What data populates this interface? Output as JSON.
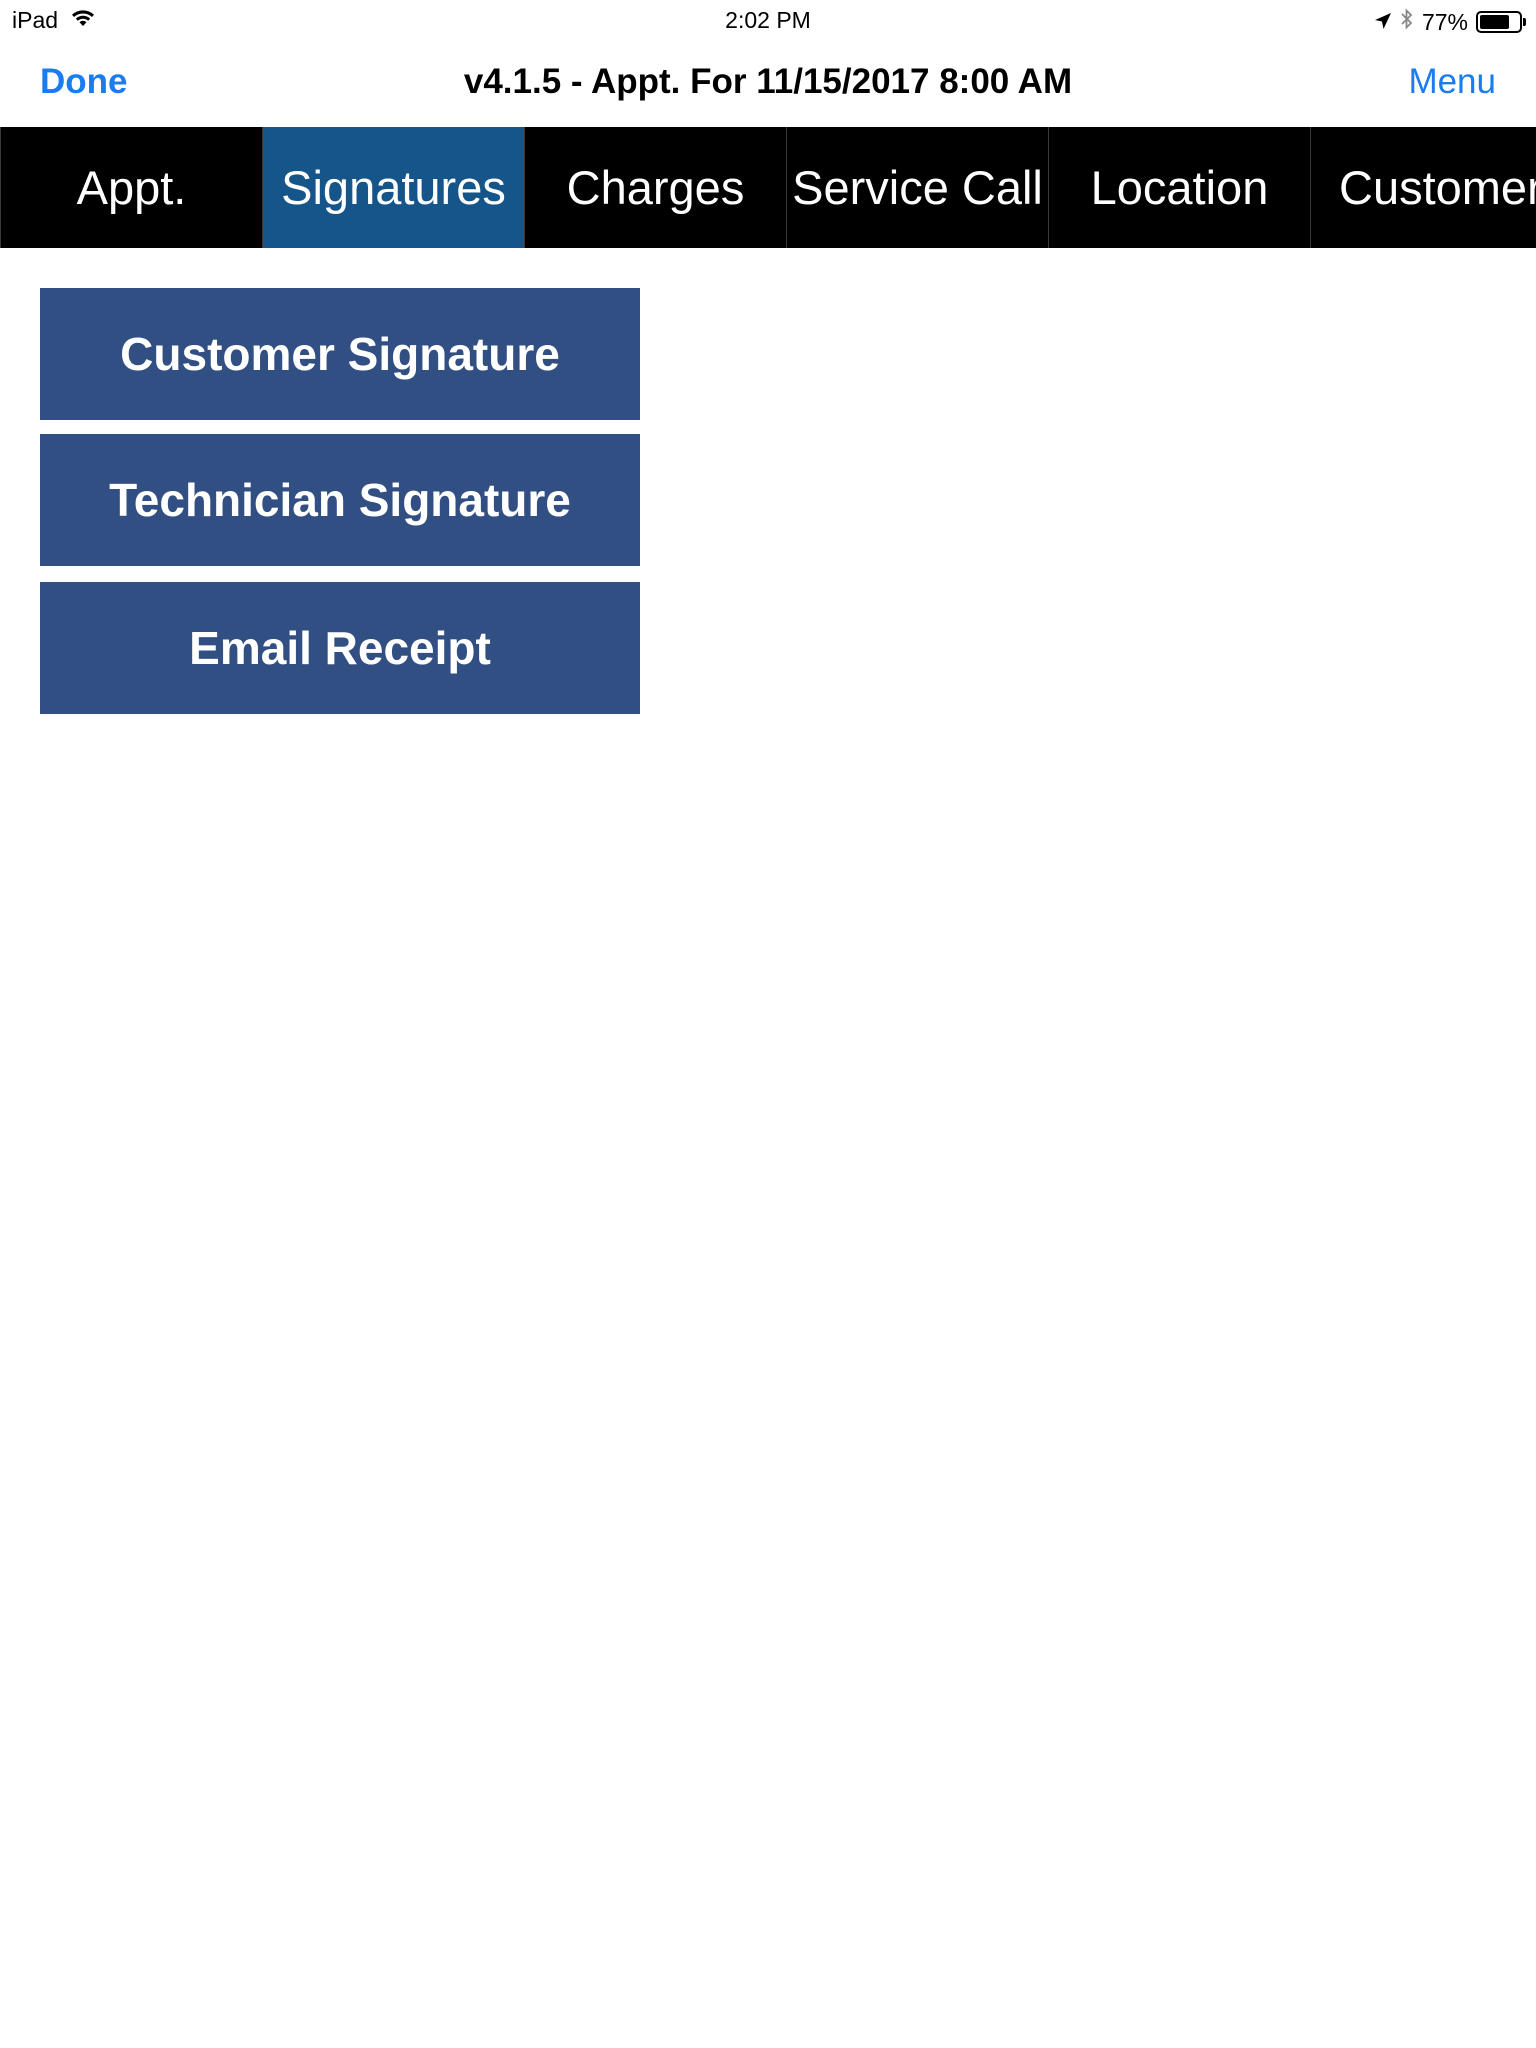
{
  "status_bar": {
    "device": "iPad",
    "time": "2:02 PM",
    "battery": "77%",
    "battery_level": 0.77,
    "icons": [
      "wifi-icon",
      "location-arrow-icon",
      "bluetooth-icon",
      "battery-icon"
    ]
  },
  "nav": {
    "done_label": "Done",
    "title": "v4.1.5 - Appt. For 11/15/2017 8:00 AM",
    "menu_label": "Menu"
  },
  "tabs": [
    {
      "label": "Appt.",
      "active": false
    },
    {
      "label": "Signatures",
      "active": true
    },
    {
      "label": "Charges",
      "active": false
    },
    {
      "label": "Service Call",
      "active": false
    },
    {
      "label": "Location",
      "active": false
    },
    {
      "label": "Customer",
      "active": false
    }
  ],
  "actions": {
    "customer_signature": "Customer Signature",
    "technician_signature": "Technician Signature",
    "email_receipt": "Email Receipt"
  },
  "colors": {
    "accent": "#1a7cf0",
    "tab_bar": "#000000",
    "tab_active": "#16558a",
    "button": "#324f83"
  }
}
